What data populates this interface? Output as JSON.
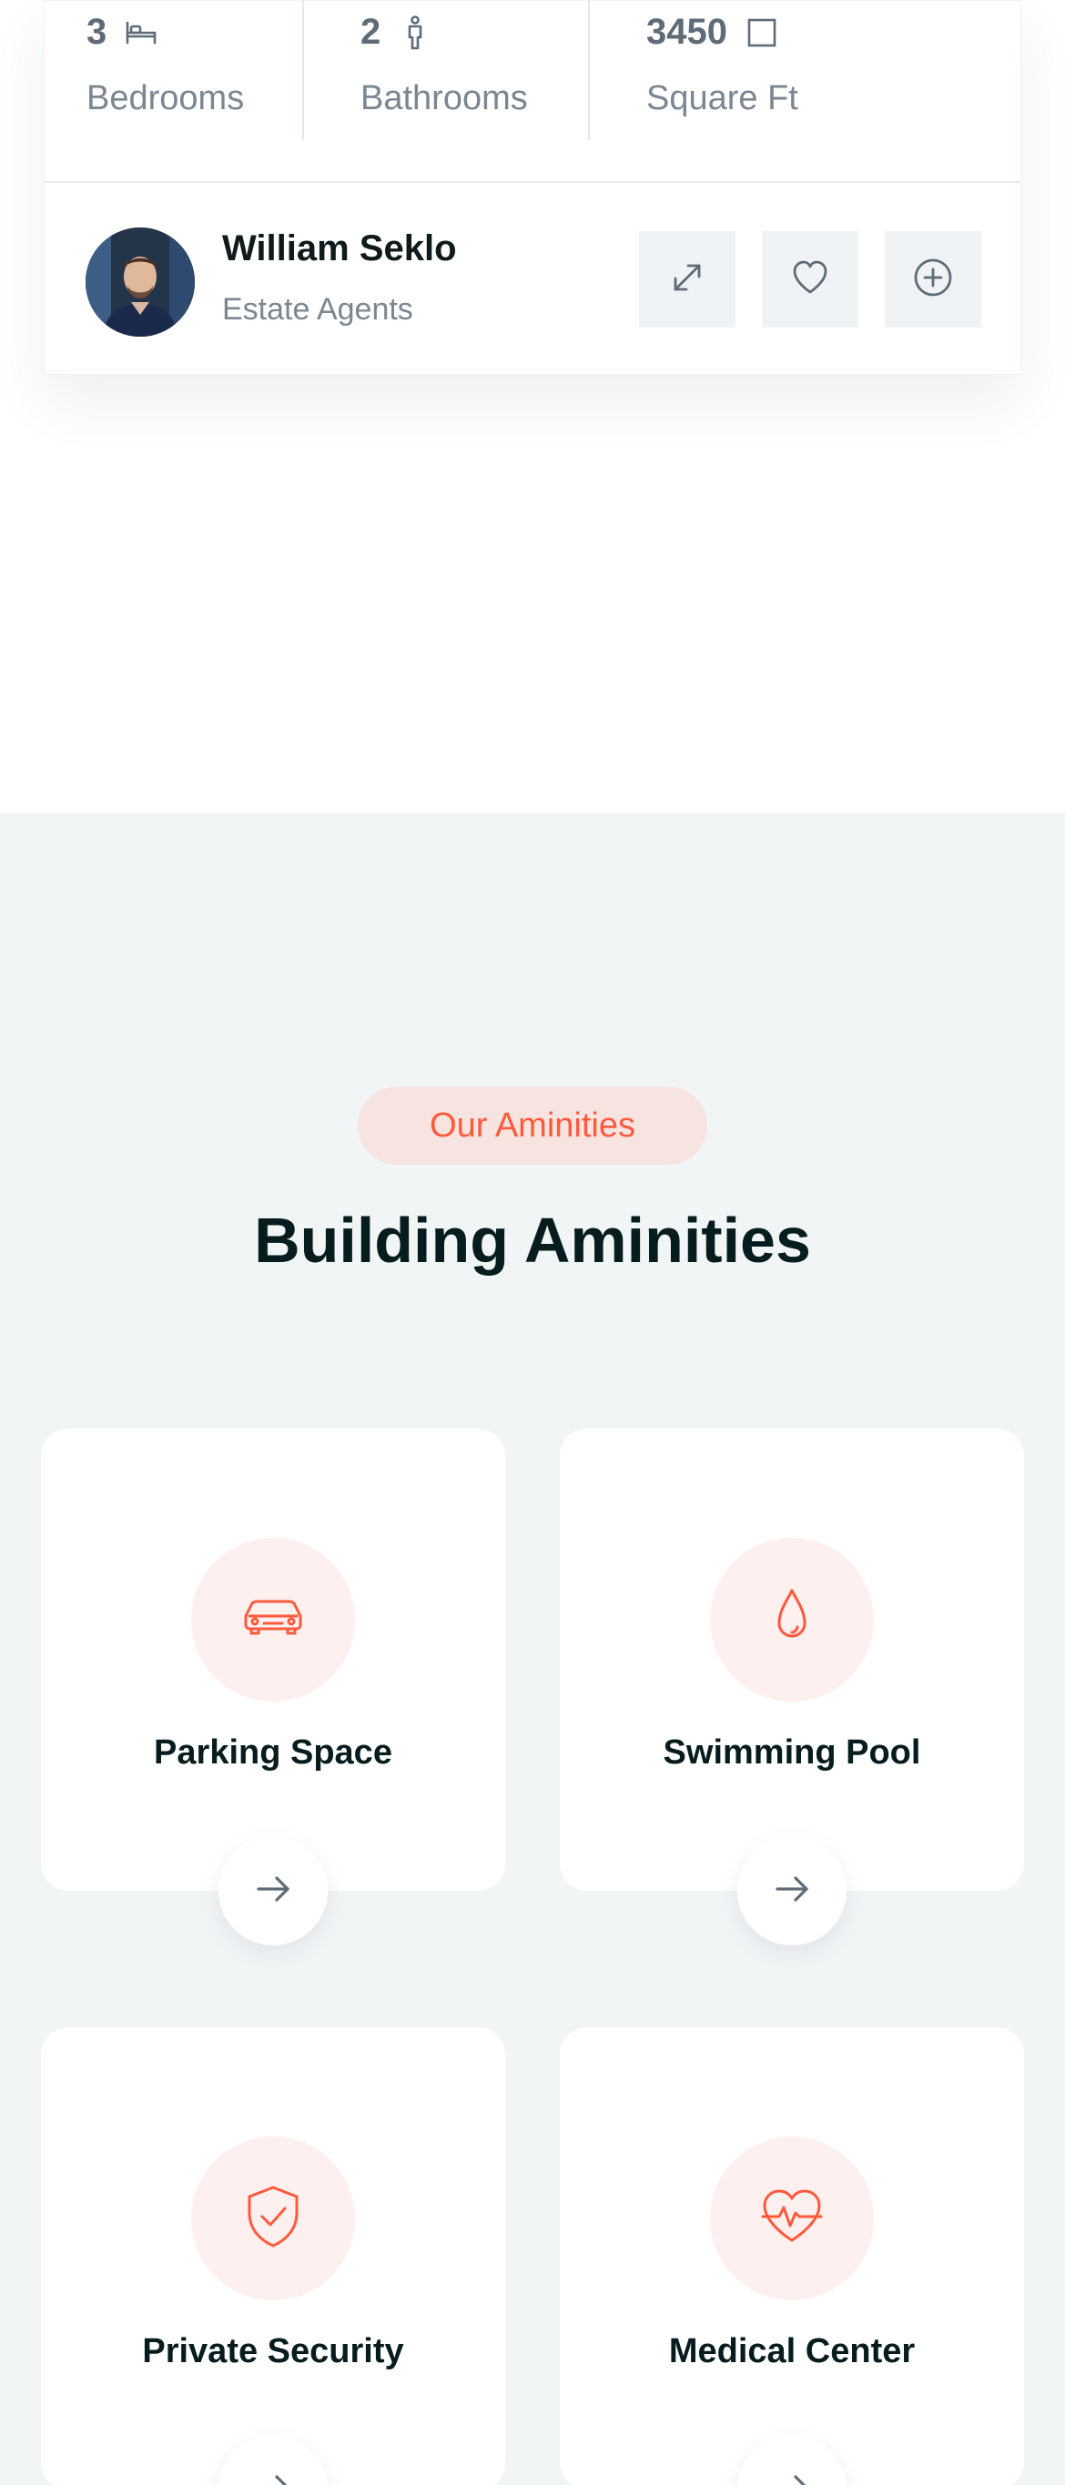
{
  "property": {
    "stats": [
      {
        "value": "3",
        "label": "Bedrooms",
        "icon": "bed-icon"
      },
      {
        "value": "2",
        "label": "Bathrooms",
        "icon": "person-icon"
      },
      {
        "value": "3450",
        "label": "Square Ft",
        "icon": "square-icon"
      }
    ],
    "agent": {
      "name": "William Seklo",
      "role": "Estate Agents"
    },
    "actions": [
      "expand-icon",
      "heart-icon",
      "plus-circle-icon"
    ]
  },
  "amenities": {
    "subtitle": "Our Aminities",
    "title": "Building Aminities",
    "accent_color": "#ff5a3c",
    "items": [
      {
        "label": "Parking Space",
        "icon": "car-icon"
      },
      {
        "label": "Swimming Pool",
        "icon": "water-drop-icon"
      },
      {
        "label": "Private Security",
        "icon": "shield-check-icon"
      },
      {
        "label": "Medical Center",
        "icon": "heart-pulse-icon"
      }
    ]
  }
}
